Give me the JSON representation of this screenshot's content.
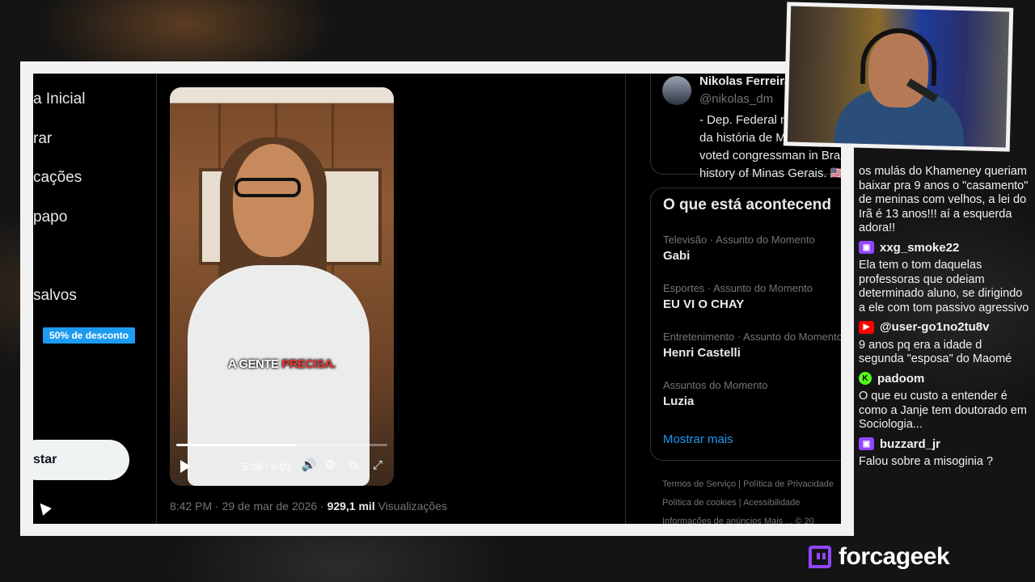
{
  "nav": {
    "items": [
      "a Inicial",
      "rar",
      "cações",
      "papo",
      "salvos"
    ],
    "promo": "50% de desconto",
    "post_button": "star"
  },
  "video": {
    "subtitle_prefix": "A GENTE ",
    "subtitle_highlight": "PRECISA.",
    "time": "5:08 / 9:01",
    "progress": 0.5698
  },
  "post": {
    "time_date": "8:42 PM · 29 de mar de 2026 · ",
    "views_count": "929,1 mil",
    "views_label": " Visualizações"
  },
  "profile": {
    "name": "Nikolas Ferreira",
    "handle": "@nikolas_dm",
    "bio": "- Dep. Federal m\nda história de Mina\nvoted congressman in Bra\nhistory of Minas Gerais. 🇺🇸"
  },
  "trends": {
    "title": "O que está acontecend",
    "items": [
      {
        "category": "Televisão · Assunto do Momento",
        "name": "Gabi"
      },
      {
        "category": "Esportes · Assunto do Momento",
        "name": "EU VI O CHAY"
      },
      {
        "category": "Entretenimento · Assunto do Momento",
        "name": "Henri Castelli"
      },
      {
        "category": "Assuntos do Momento",
        "name": "Luzia"
      }
    ],
    "show_more": "Mostrar mais"
  },
  "footer": {
    "links": [
      "Termos de Serviço",
      "Política de Privacidade",
      "Política de cookies",
      "Acessibilidade",
      "Informações de anúncios",
      "Mais ...",
      "© 20"
    ]
  },
  "chat": {
    "intro": "os mulás do Khameney queriam baixar pra 9 anos o \"casamento\" de meninas com velhos, a lei do Irã é 13 anos!!! aí a esquerda adora!!",
    "messages": [
      {
        "platform": "twitch",
        "user": "xxg_smoke22",
        "text": "Ela tem o tom daquelas professoras que odeiam determinado aluno, se dirigindo a ele com tom passivo agressivo"
      },
      {
        "platform": "youtube",
        "user": "@user-go1no2tu8v",
        "text": "9 anos pq era a idade d segunda \"esposa\" do Maomé"
      },
      {
        "platform": "kick",
        "user": "padoom",
        "text": "O que eu custo a entender é como a Janje tem doutorado em Sociologia..."
      },
      {
        "platform": "twitch",
        "user": "buzzard_jr",
        "text": "Falou sobre a misoginia ?"
      }
    ]
  },
  "brand": {
    "name": "forcageek",
    "color": "#9146ff"
  }
}
